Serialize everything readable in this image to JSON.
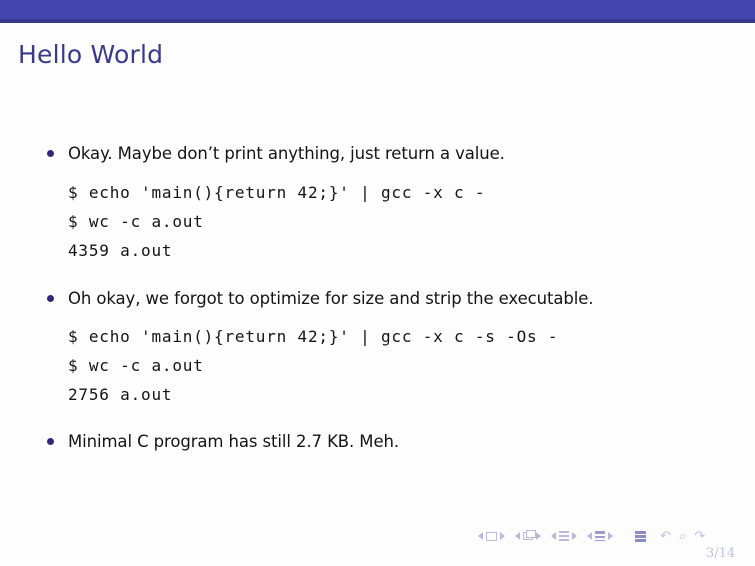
{
  "slide": {
    "frame_title": "Hello World",
    "header_bar_color": "#4545ae",
    "title_color": "#3a3a8c",
    "background_color": "#fdfdfd",
    "bullet_color": "#2b2b7a",
    "nav_color": "#b9b9dd"
  },
  "content": {
    "blocks": [
      {
        "bullet_text": "Okay. Maybe don’t print anything, just return a value.",
        "code_lines": [
          "$ echo 'main(){return 42;}' | gcc -x c -",
          "$ wc -c a.out",
          "4359 a.out"
        ]
      },
      {
        "bullet_text": "Oh okay, we forgot to optimize for size and strip the executable.",
        "code_lines": [
          "$ echo 'main(){return 42;}' | gcc -x c -s -Os -",
          "$ wc -c a.out",
          "2756 a.out"
        ]
      },
      {
        "bullet_text": "Minimal C program has still 2.7 KB. Meh.",
        "code_lines": []
      }
    ]
  },
  "footer": {
    "page_number": "3/14",
    "nav_symbols": [
      "previous-slide",
      "slide-icon",
      "next-slide",
      "previous-frame",
      "frame-icon",
      "next-frame",
      "previous-subsection",
      "subsection-icon",
      "next-subsection",
      "previous-section",
      "section-icon",
      "next-section",
      "document-icon",
      "back-icon",
      "search-icon",
      "forward-icon"
    ],
    "arrow_glyphs": "↶ ⌕ ↷"
  }
}
